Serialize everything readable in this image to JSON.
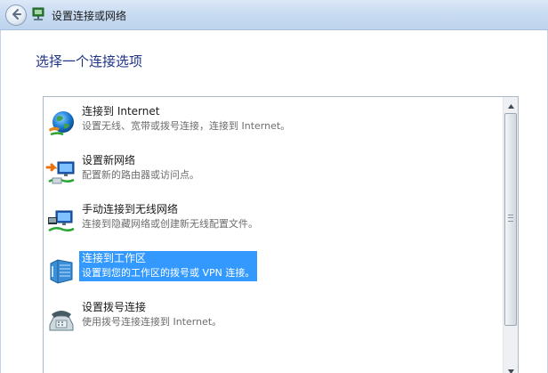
{
  "window": {
    "title": "设置连接或网络",
    "back_icon": "back-arrow-icon",
    "wizard_icon": "network-wizard-icon"
  },
  "heading": "选择一个连接选项",
  "options": [
    {
      "title": "连接到 Internet",
      "description": "设置无线、宽带或拨号连接，连接到 Internet。",
      "icon": "internet-globe-icon",
      "selected": false
    },
    {
      "title": "设置新网络",
      "description": "配置新的路由器或访问点。",
      "icon": "new-network-icon",
      "selected": false
    },
    {
      "title": "手动连接到无线网络",
      "description": "连接到隐藏网络或创建新无线配置文件。",
      "icon": "wireless-network-icon",
      "selected": false
    },
    {
      "title": "连接到工作区",
      "description": "设置到您的工作区的拨号或 VPN 连接。",
      "icon": "workplace-icon",
      "selected": true
    },
    {
      "title": "设置拨号连接",
      "description": "使用拨号连接连接到 Internet。",
      "icon": "dialup-phone-icon",
      "selected": false
    }
  ],
  "colors": {
    "selection": "#3399ff",
    "heading": "#1e3287",
    "description": "#6d6d6d"
  }
}
